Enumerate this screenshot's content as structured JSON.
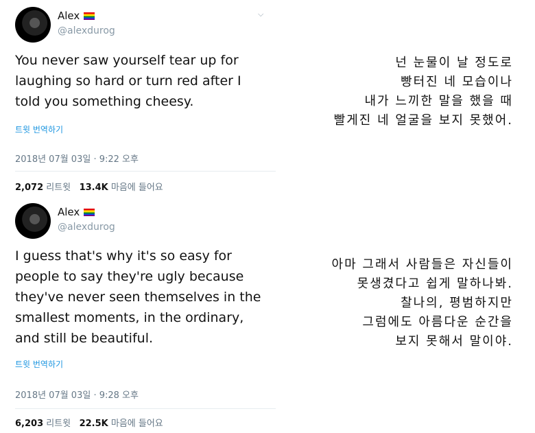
{
  "tweets": [
    {
      "name": "Alex",
      "handle": "@alexdurog",
      "text": "You never saw yourself tear up for\nlaughing so hard or turn red after I\ntold you something cheesy.",
      "translate_label": "트윗 번역하기",
      "timestamp": "2018년 07월 03일 · 9:22 오후",
      "retweets": "2,072",
      "retweets_label": "리트윗",
      "likes": "13.4K",
      "likes_label": "마음에 들어요",
      "translation": "넌 눈물이 날 정도로\n빵터진 네 모습이나\n내가 느끼한 말을 했을 때\n빨게진 네 얼굴을 보지 못했어."
    },
    {
      "name": "Alex",
      "handle": "@alexdurog",
      "text": "I guess that's why it's so easy for\npeople to say they're ugly because\nthey've never seen themselves in the\nsmallest moments, in the ordinary,\nand still be beautiful.",
      "translate_label": "트윗 번역하기",
      "timestamp": "2018년 07월 03일 · 9:28 오후",
      "retweets": "6,203",
      "retweets_label": "리트윗",
      "likes": "22.5K",
      "likes_label": "마음에 들어요",
      "translation": "아마 그래서 사람들은 자신들이\n못생겼다고 쉽게 말하나봐.\n찰나의, 평범하지만\n그럼에도 아름다운 순간을\n보지 못해서 말이야."
    }
  ],
  "colors": {
    "link": "#1b95e0",
    "meta": "#657786",
    "handle": "#8899a6"
  },
  "icons": {
    "flag": "rainbow-flag-icon",
    "menu": "chevron-down-icon"
  }
}
